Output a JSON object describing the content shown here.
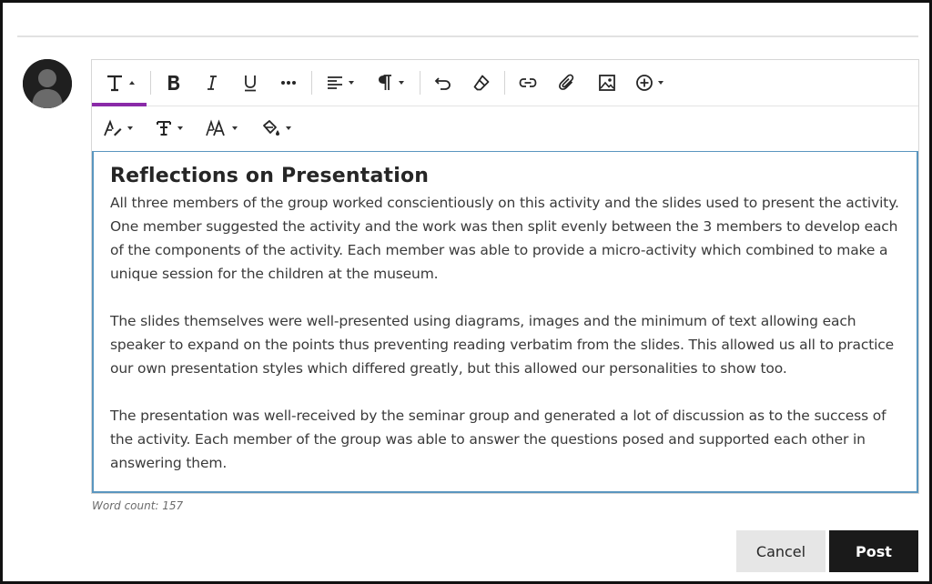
{
  "toolbar": {
    "row1": [
      {
        "icon": "text-style-icon",
        "has_caret": true,
        "active": true
      },
      {
        "icon": "bold-icon"
      },
      {
        "icon": "italic-icon"
      },
      {
        "icon": "underline-icon"
      },
      {
        "icon": "more-icon"
      },
      {
        "icon": "align-icon",
        "has_caret": true
      },
      {
        "icon": "paragraph-icon",
        "has_caret": true
      },
      {
        "icon": "undo-icon"
      },
      {
        "icon": "clear-formatting-icon"
      },
      {
        "icon": "link-icon"
      },
      {
        "icon": "attachment-icon"
      },
      {
        "icon": "image-icon"
      },
      {
        "icon": "insert-icon",
        "has_caret": true
      }
    ],
    "row2": [
      {
        "icon": "text-color-icon",
        "has_caret": true
      },
      {
        "icon": "font-family-icon",
        "has_caret": true
      },
      {
        "icon": "font-size-icon",
        "has_caret": true
      },
      {
        "icon": "highlight-icon",
        "has_caret": true
      }
    ],
    "active_color": "#8a2aa8"
  },
  "editor": {
    "heading": "Reflections on Presentation",
    "paragraphs": [
      "All three members of the group worked conscientiously on this activity and the slides used to present the activity. One member suggested the activity and the work was then split evenly between the 3 members to develop each of the components of the activity. Each member was able to provide a micro-activity which combined to make a unique session for the children at the museum.",
      "The slides themselves were well-presented using diagrams, images and the minimum of text allowing each speaker to expand on the points thus preventing reading verbatim from the slides. This allowed us all to practice our own presentation styles which differed greatly, but this allowed our personalities to show too.",
      "The presentation was well-received by the seminar group and generated a lot of discussion as to the success of the activity. Each member of the group was able to answer the questions posed and supported each other in answering them."
    ],
    "focus_border_color": "#5a96bf"
  },
  "word_count": "Word count: 157",
  "buttons": {
    "cancel_label": "Cancel",
    "post_label": "Post"
  }
}
